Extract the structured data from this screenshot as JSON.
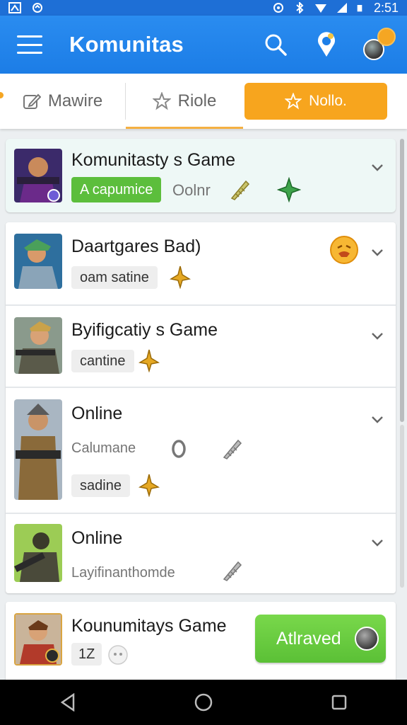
{
  "status_bar": {
    "time": "2:51"
  },
  "app_bar": {
    "title": "Komunitas"
  },
  "tabs": [
    {
      "label": "Mawire"
    },
    {
      "label": "Riole"
    },
    {
      "label": "Nollo."
    }
  ],
  "cards": [
    {
      "title": "Komunitasty s Game",
      "chip": "A capumice",
      "sub": "Oolnr"
    },
    {
      "title": "Daartgares Bad)",
      "chip": "oam satine"
    },
    {
      "title": "Byifigcatiy s Game",
      "chip": "cantine"
    },
    {
      "title": "Online",
      "sub": "Calumane",
      "chip": "sadine"
    },
    {
      "title": "Online",
      "sub": "Layifinanthomde"
    },
    {
      "title": "Kounumitays Game",
      "chip": "1Z",
      "button": "Atlraved"
    }
  ],
  "colors": {
    "primary": "#1e7fe8",
    "accent": "#f7a51e",
    "green": "#5cbe3c"
  }
}
